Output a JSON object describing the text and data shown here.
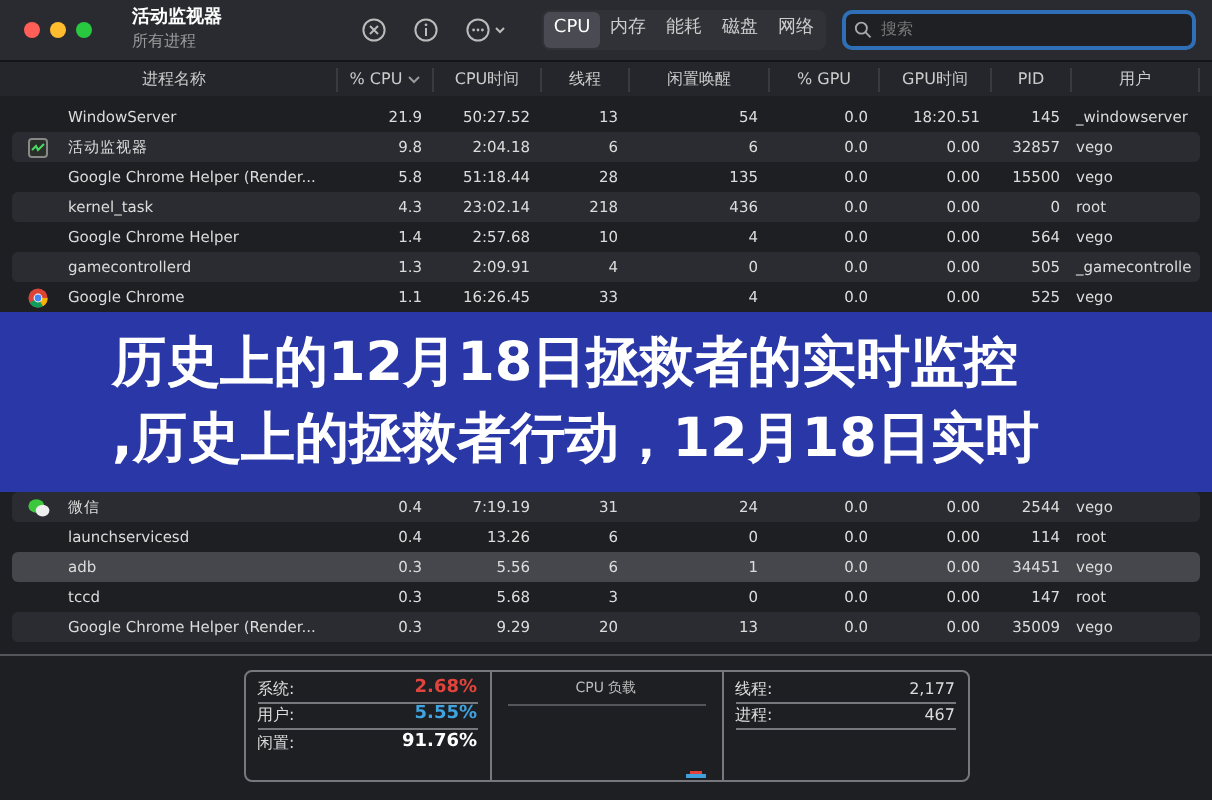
{
  "window": {
    "title": "活动监视器",
    "subtitle": "所有进程"
  },
  "tabs": [
    {
      "label": "CPU",
      "selected": true
    },
    {
      "label": "内存",
      "selected": false
    },
    {
      "label": "能耗",
      "selected": false
    },
    {
      "label": "磁盘",
      "selected": false
    },
    {
      "label": "网络",
      "selected": false
    }
  ],
  "search": {
    "placeholder": "搜索"
  },
  "table": {
    "columns": [
      "进程名称",
      "% CPU",
      "CPU时间",
      "线程",
      "闲置唤醒",
      "% GPU",
      "GPU时间",
      "PID",
      "用户"
    ],
    "rows": [
      {
        "kind": "plain",
        "selected": false,
        "cells": [
          "WindowServer",
          "21.9",
          "50:27.52",
          "13",
          "54",
          "0.0",
          "18:20.51",
          "145",
          "_windowserver"
        ]
      },
      {
        "kind": "monitor",
        "selected": false,
        "cells": [
          "活动监视器",
          "9.8",
          "2:04.18",
          "6",
          "6",
          "0.0",
          "0.00",
          "32857",
          "vego"
        ]
      },
      {
        "kind": "plain",
        "selected": false,
        "cells": [
          "Google Chrome Helper (Render...",
          "5.8",
          "51:18.44",
          "28",
          "135",
          "0.0",
          "0.00",
          "15500",
          "vego"
        ]
      },
      {
        "kind": "plain",
        "selected": false,
        "cells": [
          "kernel_task",
          "4.3",
          "23:02.14",
          "218",
          "436",
          "0.0",
          "0.00",
          "0",
          "root"
        ]
      },
      {
        "kind": "plain",
        "selected": false,
        "cells": [
          "Google Chrome Helper",
          "1.4",
          "2:57.68",
          "10",
          "4",
          "0.0",
          "0.00",
          "564",
          "vego"
        ]
      },
      {
        "kind": "plain",
        "selected": false,
        "cells": [
          "gamecontrollerd",
          "1.3",
          "2:09.91",
          "4",
          "0",
          "0.0",
          "0.00",
          "505",
          "_gamecontrolle"
        ]
      },
      {
        "kind": "chrome",
        "selected": false,
        "cells": [
          "Google Chrome",
          "1.1",
          "16:26.45",
          "33",
          "4",
          "0.0",
          "0.00",
          "525",
          "vego"
        ]
      },
      {
        "kind": "chat",
        "selected": false,
        "cells": [
          "微信",
          "0.4",
          "7:19.19",
          "31",
          "24",
          "0.0",
          "0.00",
          "2544",
          "vego"
        ]
      },
      {
        "kind": "plain",
        "selected": false,
        "cells": [
          "launchservicesd",
          "0.4",
          "13.26",
          "6",
          "0",
          "0.0",
          "0.00",
          "114",
          "root"
        ]
      },
      {
        "kind": "plain",
        "selected": true,
        "cells": [
          "adb",
          "0.3",
          "5.56",
          "6",
          "1",
          "0.0",
          "0.00",
          "34451",
          "vego"
        ]
      },
      {
        "kind": "plain",
        "selected": false,
        "cells": [
          "tccd",
          "0.3",
          "5.68",
          "3",
          "0",
          "0.0",
          "0.00",
          "147",
          "root"
        ]
      },
      {
        "kind": "plain",
        "selected": false,
        "cells": [
          "Google Chrome Helper (Render...",
          "0.3",
          "9.29",
          "20",
          "13",
          "0.0",
          "0.00",
          "35009",
          "vego"
        ]
      }
    ]
  },
  "banner": {
    "lines": [
      "历史上的12月18日拯救者的实时监控",
      ",历史上的拯救者行动，12月18日实时"
    ]
  },
  "summary": {
    "cpu_stats": [
      {
        "label": "系统:",
        "value": "2.68%",
        "color": "#e0443c"
      },
      {
        "label": "用户:",
        "value": "5.55%",
        "color": "#3fa3e0"
      },
      {
        "label": "闲置:",
        "value": "91.76%",
        "color": "#ffffff"
      }
    ],
    "load_title": "CPU 负载",
    "counts": [
      {
        "label": "线程:",
        "value": "2,177"
      },
      {
        "label": "进程:",
        "value": "467"
      }
    ]
  }
}
